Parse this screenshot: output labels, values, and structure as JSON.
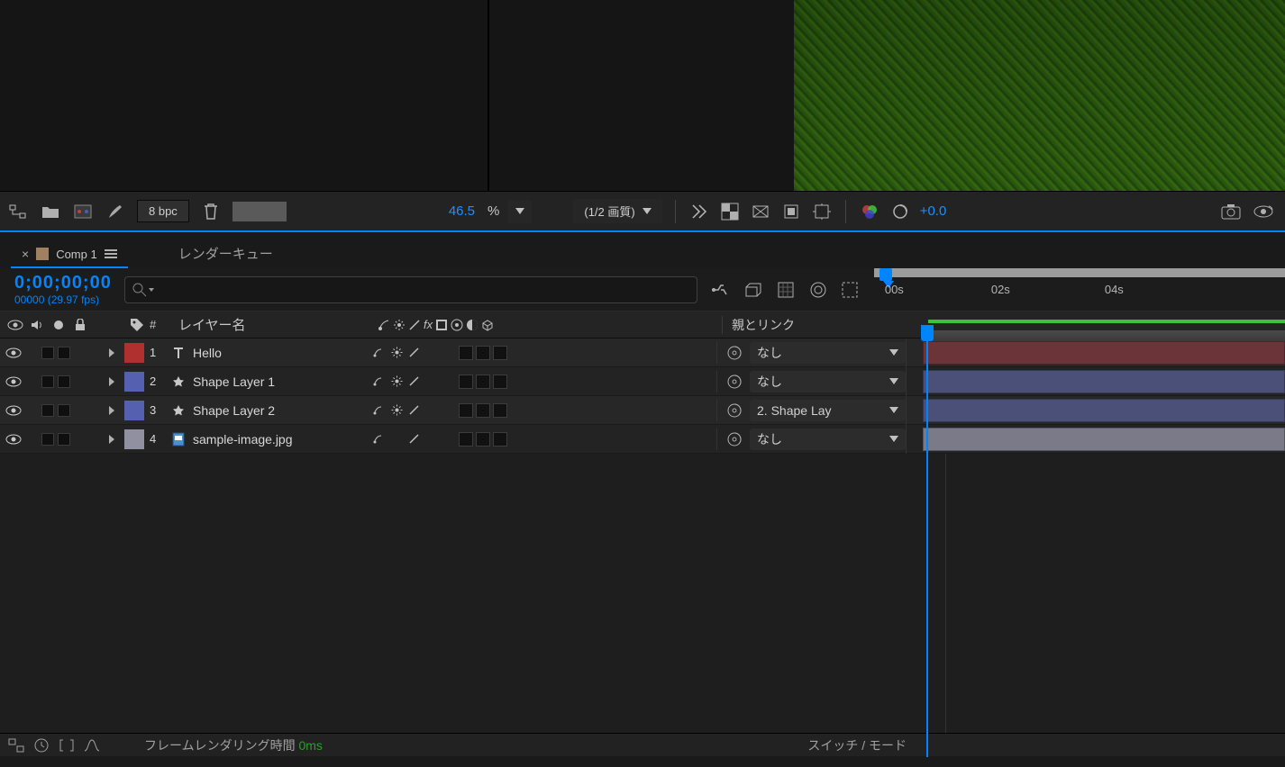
{
  "toolbar": {
    "bpc": "8 bpc",
    "zoom_value": "46.5",
    "zoom_unit": "%",
    "quality": "(1/2 画質)",
    "exposure": "+0.0"
  },
  "tabs": {
    "main": "Comp 1",
    "secondary": "レンダーキュー"
  },
  "timeline": {
    "timecode": "0;00;00;00",
    "frames_fps": "00000 (29.97 fps)",
    "ruler_ticks": [
      "00s",
      "02s",
      "04s"
    ]
  },
  "columns": {
    "number": "#",
    "layer_name": "レイヤー名",
    "parent_link": "親とリンク"
  },
  "layers": [
    {
      "index": 1,
      "name": "Hello",
      "type": "text",
      "label_color": "#b03030",
      "parent": "なし",
      "bar": "bar-red"
    },
    {
      "index": 2,
      "name": "Shape Layer 1",
      "type": "shape",
      "label_color": "#5560b0",
      "parent": "なし",
      "bar": "bar-blue"
    },
    {
      "index": 3,
      "name": "Shape Layer 2",
      "type": "shape",
      "label_color": "#5560b0",
      "parent": "2. Shape Lay",
      "bar": "bar-blue"
    },
    {
      "index": 4,
      "name": "sample-image.jpg",
      "type": "image",
      "label_color": "#9090a0",
      "parent": "なし",
      "bar": "bar-gray"
    }
  ],
  "bottom": {
    "render_time_label": "フレームレンダリング時間 ",
    "render_time_value": "0ms",
    "switch_mode": "スイッチ / モード"
  }
}
